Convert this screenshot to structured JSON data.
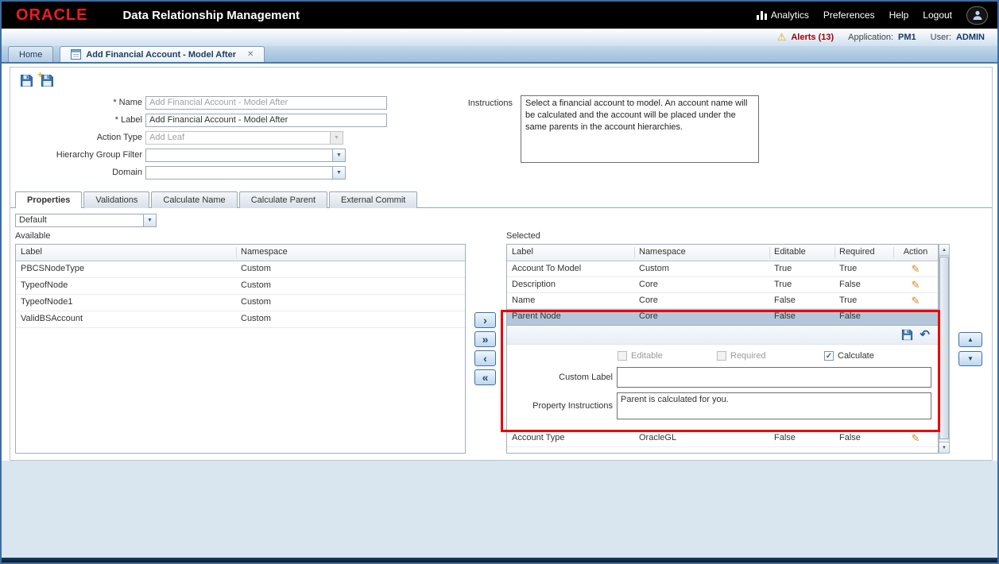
{
  "header": {
    "brand": "ORACLE",
    "title": "Data Relationship Management",
    "analytics": "Analytics",
    "preferences": "Preferences",
    "help": "Help",
    "logout": "Logout"
  },
  "infobar": {
    "alerts": "Alerts (13)",
    "application_label": "Application:",
    "application_value": "PM1",
    "user_label": "User:",
    "user_value": "ADMIN"
  },
  "tabs": {
    "home": "Home",
    "active": "Add Financial Account - Model After",
    "close": "✕"
  },
  "form": {
    "name_label": "* Name",
    "name_value": "Add Financial Account - Model After",
    "label_label": "* Label",
    "label_value": "Add Financial Account - Model After",
    "action_type_label": "Action Type",
    "action_type_value": "Add Leaf",
    "hierarchy_filter_label": "Hierarchy Group Filter",
    "hierarchy_filter_value": "",
    "domain_label": "Domain",
    "domain_value": "",
    "instructions_label": "Instructions",
    "instructions_value": "Select a financial account to model.  An account name will be calculated and the account will be placed under the same parents in the account hierarchies."
  },
  "section_tabs": {
    "items": [
      "Properties",
      "Validations",
      "Calculate Name",
      "Calculate Parent",
      "External Commit"
    ]
  },
  "properties": {
    "category_value": "Default",
    "available_title": "Available",
    "available_columns": {
      "label": "Label",
      "namespace": "Namespace"
    },
    "available_rows": [
      {
        "label": "PBCSNodeType",
        "namespace": "Custom"
      },
      {
        "label": "TypeofNode",
        "namespace": "Custom"
      },
      {
        "label": "TypeofNode1",
        "namespace": "Custom"
      },
      {
        "label": "ValidBSAccount",
        "namespace": "Custom"
      }
    ],
    "selected_title": "Selected",
    "selected_columns": {
      "label": "Label",
      "namespace": "Namespace",
      "editable": "Editable",
      "required": "Required",
      "action": "Action"
    },
    "selected_rows": [
      {
        "label": "Account To Model",
        "namespace": "Custom",
        "editable": "True",
        "required": "True"
      },
      {
        "label": "Description",
        "namespace": "Core",
        "editable": "True",
        "required": "False"
      },
      {
        "label": "Name",
        "namespace": "Core",
        "editable": "False",
        "required": "True"
      },
      {
        "label": "Parent Node",
        "namespace": "Core",
        "editable": "False",
        "required": "False"
      },
      {
        "label": "Account Type",
        "namespace": "OracleGL",
        "editable": "False",
        "required": "False"
      }
    ],
    "editor": {
      "editable_label": "Editable",
      "required_label": "Required",
      "calculate_label": "Calculate",
      "custom_label_label": "Custom Label",
      "custom_label_value": "",
      "instructions_label": "Property Instructions",
      "instructions_value": "Parent is calculated for you."
    }
  },
  "icons": {
    "alert": "⚠",
    "pencil": "✎",
    "undo": "↶",
    "dropdown": "▼",
    "up": "▲",
    "down": "▼",
    "check": "✓",
    "move_right": "›",
    "move_all_right": "»",
    "move_left": "‹",
    "move_all_left": "«"
  }
}
